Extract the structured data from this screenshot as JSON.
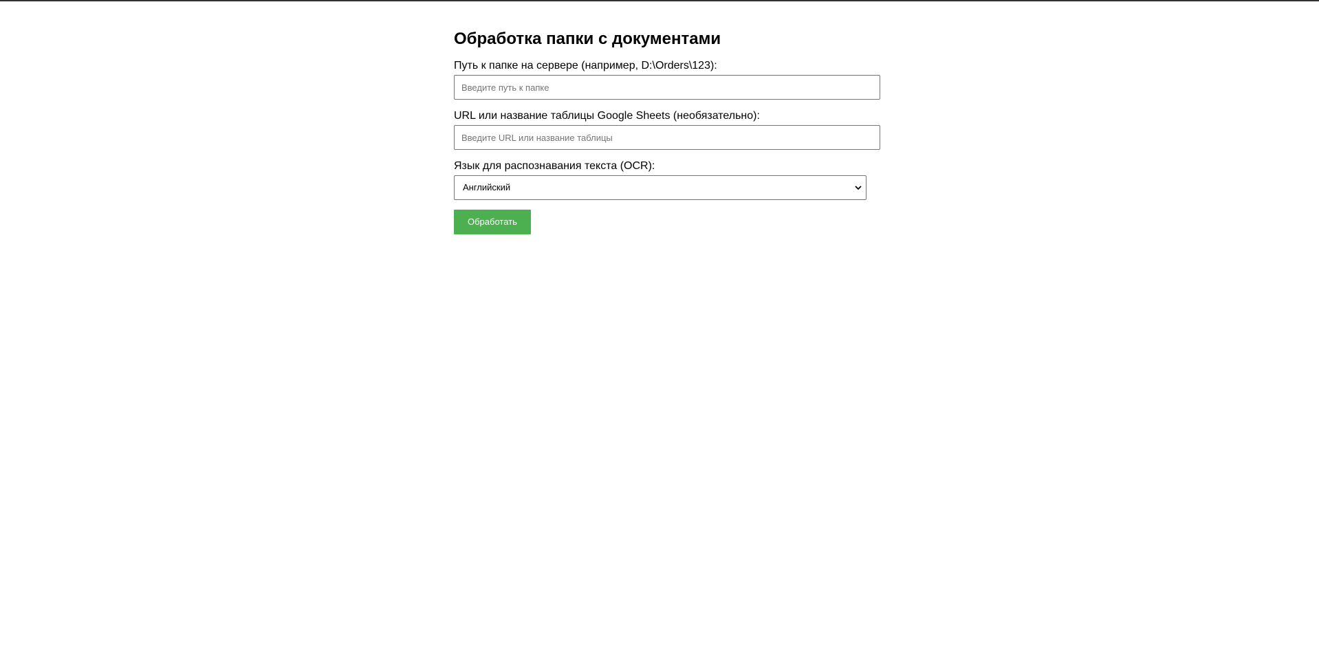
{
  "form": {
    "title": "Обработка папки с документами",
    "folder_path": {
      "label": "Путь к папке на сервере (например, D:\\Orders\\123):",
      "value": "",
      "placeholder": "Введите путь к папке"
    },
    "sheet": {
      "label": "URL или название таблицы Google Sheets (необязательно):",
      "value": "",
      "placeholder": "Введите URL или название таблицы"
    },
    "ocr_language": {
      "label": "Язык для распознавания текста (OCR):",
      "selected": "Английский",
      "icon": "chevron-down-icon"
    },
    "submit": {
      "label": "Обработать",
      "color": "#4caf50"
    }
  }
}
